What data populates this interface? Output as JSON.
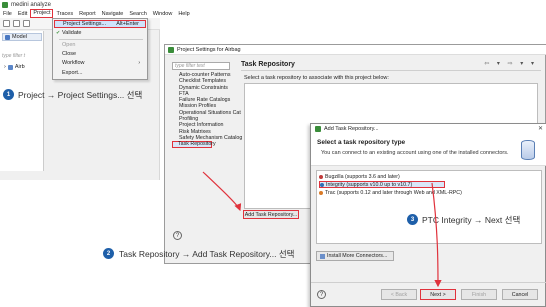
{
  "app": {
    "title": "medini analyze",
    "menu": [
      "File",
      "Edit",
      "Project",
      "Traces",
      "Report",
      "Navigate",
      "Search",
      "Window",
      "Help"
    ],
    "model_tab": "Model",
    "filter_placeholder": "type filter t",
    "tree_item": "Airb"
  },
  "project_menu": {
    "items": [
      {
        "label": "Project Settings...",
        "accel": "Alt+Enter"
      },
      {
        "label": "Validate",
        "accel": ""
      },
      {
        "label": "Open",
        "accel": ""
      },
      {
        "label": "Close",
        "accel": ""
      },
      {
        "label": "Workflow",
        "accel": ""
      },
      {
        "label": "Export...",
        "accel": ""
      }
    ]
  },
  "steps": [
    {
      "num": "1",
      "text": "Project → Project Settings... 선택"
    },
    {
      "num": "2",
      "text": "Task Repository → Add Task Repository... 선택"
    },
    {
      "num": "3",
      "text": "PTC Integrity → Next 선택"
    }
  ],
  "settings_dialog": {
    "title": "Project Settings for Airbag",
    "filter_placeholder": "type filter text",
    "categories": [
      "Auto-counter Patterns",
      "Checklist Templates",
      "Dynamic Constraints",
      "FTA",
      "Failure Rate Catalogs",
      "Mission Profiles",
      "Operational Situations Cat",
      "Profiling",
      "Project Information",
      "Risk Matrixes",
      "Safety Mechanism Catalog",
      "Task Repository"
    ],
    "page_title": "Task Repository",
    "description": "Select a task repository to associate with this project below:",
    "add_button": "Add Task Repository...",
    "help": "?"
  },
  "wizard": {
    "window_title": "Add Task Repository...",
    "heading": "Select a task repository type",
    "description": "You can connect to an existing account using one of the installed connectors.",
    "connectors": [
      "Bugzilla (supports 3.6 and later)",
      "Integrity (supports v10.0 up to v10.7)",
      "Trac (supports 0.12 and later through Web and XML-RPC)"
    ],
    "install_button": "Install More Connectors...",
    "buttons": {
      "back": "< Back",
      "next": "Next >",
      "finish": "Finish",
      "cancel": "Cancel"
    },
    "help": "?"
  },
  "colors": {
    "highlight": "#e0323c",
    "badge": "#1e5fa9",
    "selection": "#d9e7f8"
  }
}
